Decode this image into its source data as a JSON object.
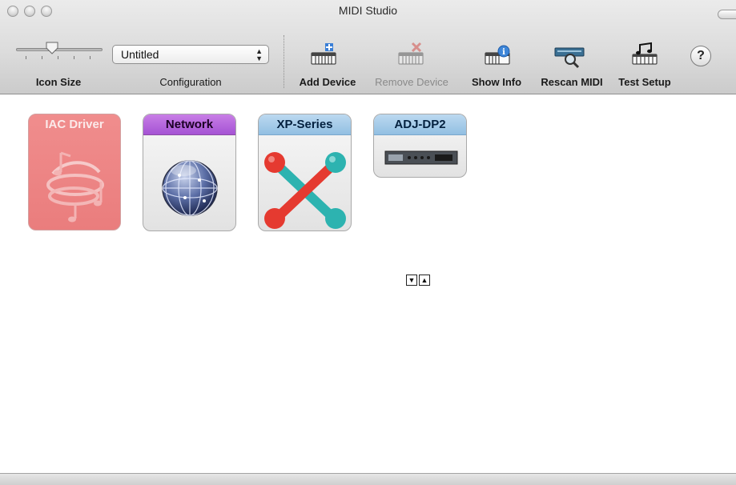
{
  "window": {
    "title": "MIDI Studio"
  },
  "toolbar": {
    "icon_size_label": "Icon Size",
    "icon_size_level": 0.4,
    "configuration_label": "Configuration",
    "configuration_value": "Untitled",
    "add_device_label": "Add Device",
    "remove_device_label": "Remove Device",
    "show_info_label": "Show Info",
    "rescan_midi_label": "Rescan MIDI",
    "test_setup_label": "Test Setup",
    "help_label": "?"
  },
  "devices": [
    {
      "name": "IAC Driver",
      "color": "#ea7d7d",
      "icon": "music-notes-icon",
      "state": "offline"
    },
    {
      "name": "Network",
      "color": "#a553d4",
      "icon": "network-globe-icon",
      "state": "online"
    },
    {
      "name": "XP-Series",
      "color": "#92bfe2",
      "icon": "xp-series-icon",
      "state": "online"
    },
    {
      "name": "ADJ-DP2",
      "color": "#92bfe2",
      "icon": "rack-device-icon",
      "state": "online",
      "expander_down": "▼",
      "expander_up": "▲"
    }
  ]
}
